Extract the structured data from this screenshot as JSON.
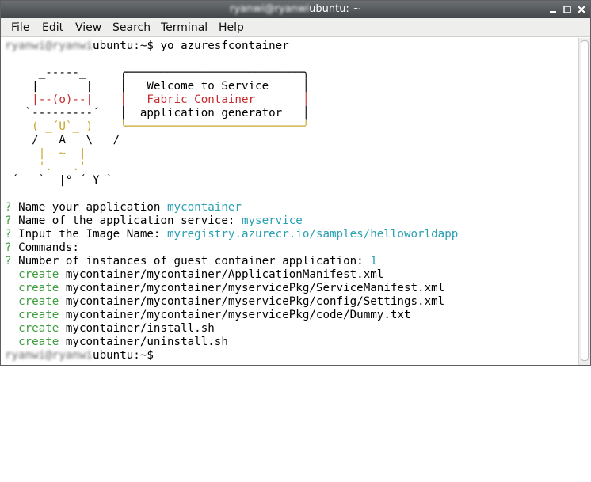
{
  "window": {
    "title_blurred": "ryanwi@ryanwi",
    "title_suffix": "ubuntu: ~"
  },
  "menu": [
    "File",
    "Edit",
    "View",
    "Search",
    "Terminal",
    "Help"
  ],
  "prompt": {
    "user_blurred": "ryanwi@ryanwi",
    "host": "ubuntu:~$",
    "command": " yo azuresfcontainer"
  },
  "ascii_art": [
    "     _-----_     ╭──────────────────────────╮",
    "    |       |    │   Welcome to Service     │",
    "    |--(o)--|    │   Fabric Container       │",
    "   `---------´   │  application generator   │",
    "    ( _´U`_ )    ╰──────────────────────────╯",
    "    /___A___\\   /",
    "     |  ~  |",
    "   __'.___.'__",
    " ´   `  |° ´ Y `"
  ],
  "answers": [
    {
      "q": "Name your application ",
      "a": "mycontainer"
    },
    {
      "q": "Name of the application service: ",
      "a": "myservice"
    },
    {
      "q": "Input the Image Name: ",
      "a": "myregistry.azurecr.io/samples/helloworldapp"
    },
    {
      "q": "Commands:",
      "a": ""
    },
    {
      "q": "Number of instances of guest container application: ",
      "a": "1"
    }
  ],
  "create_word": "create",
  "files": [
    "mycontainer/mycontainer/ApplicationManifest.xml",
    "mycontainer/mycontainer/myservicePkg/ServiceManifest.xml",
    "mycontainer/mycontainer/myservicePkg/config/Settings.xml",
    "mycontainer/mycontainer/myservicePkg/code/Dummy.txt",
    "mycontainer/install.sh",
    "mycontainer/uninstall.sh"
  ],
  "colors": {
    "cyan": "#2aa1b3",
    "green": "#3f9c3f",
    "red": "#c72c2c",
    "yellow": "#c7a52a"
  }
}
